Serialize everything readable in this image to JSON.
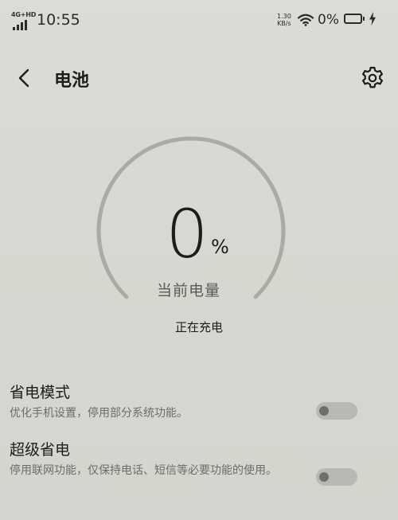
{
  "status_bar": {
    "network": "4G+HD",
    "time": "10:55",
    "speed_value": "1.30",
    "speed_unit": "KB/s",
    "battery_percent": "0%"
  },
  "header": {
    "title": "电池"
  },
  "gauge": {
    "value": "0",
    "unit": "%",
    "label": "当前电量",
    "status": "正在充电",
    "level_fraction": 0
  },
  "settings": [
    {
      "title": "省电模式",
      "description": "优化手机设置，停用部分系统功能。",
      "enabled": false
    },
    {
      "title": "超级省电",
      "description": "停用联网功能，仅保持电话、短信等必要功能的使用。",
      "enabled": false
    }
  ],
  "icons": {
    "back": "back-arrow-icon",
    "settings": "gear-icon",
    "wifi": "wifi-icon",
    "battery": "battery-icon",
    "charging": "lightning-bolt-icon",
    "signal": "signal-strength-icon"
  },
  "colors": {
    "background": "#d8dbd4",
    "gauge_track": "#a9aca5",
    "text_primary": "#1c1c1c",
    "text_secondary": "#6c6c6c",
    "toggle_off": "#b7bab3"
  }
}
